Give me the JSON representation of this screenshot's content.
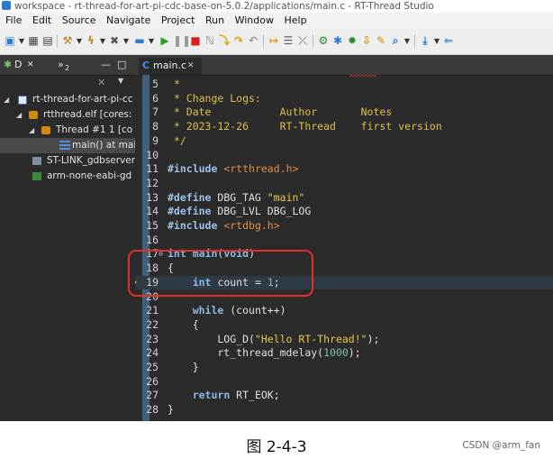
{
  "window": {
    "title": "workspace - rt-thread-for-art-pi-cdc-base-on-5.0.2/applications/main.c - RT-Thread Studio"
  },
  "menubar": {
    "items": [
      "File",
      "Edit",
      "Source",
      "Navigate",
      "Project",
      "Run",
      "Window",
      "Help"
    ]
  },
  "toolbar": {
    "icons": [
      "new-icon",
      "save-icon",
      "save-all-icon",
      "build-icon",
      "debug-icon",
      "tools-icon",
      "terminal-icon",
      "resume-icon",
      "suspend-icon",
      "terminate-icon",
      "disconnect-icon",
      "step-into-icon",
      "step-over-icon",
      "step-return-icon",
      "drop-frame-icon",
      "instruction-stepping-icon",
      "settings-icon",
      "download-icon",
      "debug-config-icon",
      "run-config-icon",
      "search-icon",
      "sdk-manager-icon",
      "back-icon"
    ],
    "colors": {
      "run": "#2aa02a",
      "stop": "#d81e1e",
      "debug": "#f0b400",
      "info": "#2b7bd3"
    }
  },
  "left_panel": {
    "tab_label": "D",
    "tab_close": "✕",
    "overflow_label": "»",
    "overflow_count": "2",
    "minimize_glyph": "—",
    "maximize_glyph": "□",
    "tree": [
      {
        "indent": 0,
        "twisty": "◢",
        "icon": "c-project-icon",
        "label": "rt-thread-for-art-pi-cc"
      },
      {
        "indent": 1,
        "twisty": "◢",
        "icon": "elf-launch-icon",
        "label": "rtthread.elf [cores:"
      },
      {
        "indent": 2,
        "twisty": "◢",
        "icon": "thread-icon",
        "label": "Thread #1 1 [co"
      },
      {
        "indent": 3,
        "twisty": "",
        "icon": "stack-frame-icon",
        "label": "main() at mai",
        "selected": true
      },
      {
        "indent": 1,
        "twisty": "",
        "icon": "gdb-server-icon",
        "label": "ST-LINK_gdbserver"
      },
      {
        "indent": 1,
        "twisty": "",
        "icon": "gdb-icon",
        "label": "arm-none-eabi-gd"
      }
    ]
  },
  "editor": {
    "tab_icon_letter": "C",
    "tab_label": "main.c",
    "tab_close": "✕",
    "current_line": 19,
    "lines": [
      {
        "n": "5",
        "parts": [
          [
            "cm",
            " *"
          ]
        ]
      },
      {
        "n": "6",
        "parts": [
          [
            "cm",
            " * Change Logs:"
          ]
        ]
      },
      {
        "n": "7",
        "parts": [
          [
            "cm",
            " * Date           Author       Notes"
          ]
        ]
      },
      {
        "n": "8",
        "parts": [
          [
            "cm",
            " * 2023-12-26     RT-Thread    first version"
          ]
        ]
      },
      {
        "n": "9",
        "parts": [
          [
            "cm",
            " */"
          ]
        ]
      },
      {
        "n": "10",
        "parts": []
      },
      {
        "n": "11",
        "parts": [
          [
            "pp",
            "#include"
          ],
          [
            "plain",
            " "
          ],
          [
            "inc",
            "<rtthread.h>"
          ]
        ]
      },
      {
        "n": "12",
        "parts": []
      },
      {
        "n": "13",
        "parts": [
          [
            "pp",
            "#define"
          ],
          [
            "plain",
            " DBG_TAG "
          ],
          [
            "st",
            "\"main\""
          ]
        ]
      },
      {
        "n": "14",
        "parts": [
          [
            "pp",
            "#define"
          ],
          [
            "plain",
            " DBG_LVL DBG_LOG"
          ]
        ]
      },
      {
        "n": "15",
        "parts": [
          [
            "pp",
            "#include"
          ],
          [
            "plain",
            " "
          ],
          [
            "inc",
            "<rtdbg.h>"
          ]
        ]
      },
      {
        "n": "16",
        "parts": []
      },
      {
        "n": "17",
        "fold": "⊖",
        "parts": [
          [
            "kw",
            "int"
          ],
          [
            "plain",
            " "
          ],
          [
            "kw",
            "main"
          ],
          [
            "plain",
            "("
          ],
          [
            "kw",
            "void"
          ],
          [
            "plain",
            ")"
          ]
        ]
      },
      {
        "n": "18",
        "parts": [
          [
            "plain",
            "{"
          ]
        ]
      },
      {
        "n": "19",
        "arrow": "➜",
        "parts": [
          [
            "plain",
            "    "
          ],
          [
            "kw",
            "int"
          ],
          [
            "plain",
            " count = "
          ],
          [
            "nm",
            "1"
          ],
          [
            "plain",
            ";"
          ]
        ]
      },
      {
        "n": "20",
        "parts": []
      },
      {
        "n": "21",
        "parts": [
          [
            "plain",
            "    "
          ],
          [
            "kw",
            "while"
          ],
          [
            "plain",
            " (count++)"
          ]
        ]
      },
      {
        "n": "22",
        "parts": [
          [
            "plain",
            "    {"
          ]
        ]
      },
      {
        "n": "23",
        "parts": [
          [
            "plain",
            "        LOG_D("
          ],
          [
            "st",
            "\"Hello RT-Thread!\""
          ],
          [
            "plain",
            ");"
          ]
        ]
      },
      {
        "n": "24",
        "parts": [
          [
            "plain",
            "        rt_thread_mdelay("
          ],
          [
            "nm",
            "1000"
          ],
          [
            "plain",
            ");"
          ]
        ]
      },
      {
        "n": "25",
        "parts": [
          [
            "plain",
            "    }"
          ]
        ]
      },
      {
        "n": "26",
        "parts": []
      },
      {
        "n": "27",
        "parts": [
          [
            "plain",
            "    "
          ],
          [
            "kw",
            "return"
          ],
          [
            "plain",
            " RT_EOK;"
          ]
        ]
      },
      {
        "n": "28",
        "parts": [
          [
            "plain",
            "}"
          ]
        ]
      }
    ]
  },
  "caption": "图 2-4-3",
  "watermark": "CSDN @arm_fan"
}
